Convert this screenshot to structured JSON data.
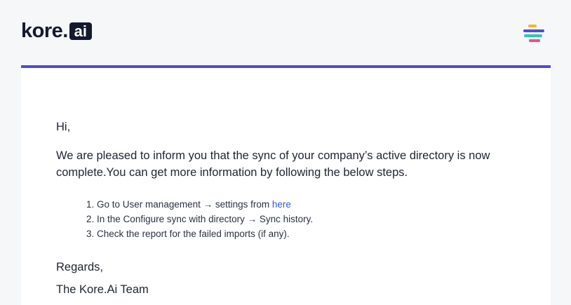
{
  "header": {
    "logo_text": "kore.",
    "logo_badge": "ai",
    "colors": {
      "logo": "#141a2e",
      "accent_bar": "#4f4cd8",
      "menu_lines": [
        "#f2b632",
        "#4f4cd8",
        "#2fc6b0",
        "#e8557a"
      ]
    },
    "menu_icon": "colorful-menu-icon"
  },
  "email": {
    "greeting": "Hi,",
    "message": "We are pleased to inform you that the sync of your company’s active directory is now complete.You can get more information by following the below steps.",
    "steps": [
      {
        "number": "1.",
        "text": "Go to User management → settings from ",
        "link": "here"
      },
      {
        "number": "2.",
        "text": "In the Configure sync with directory → Sync history."
      },
      {
        "number": "3.",
        "text": "Check the report for the failed imports (if any)."
      }
    ],
    "regards": "Regards,",
    "signature": "The Kore.Ai Team"
  }
}
